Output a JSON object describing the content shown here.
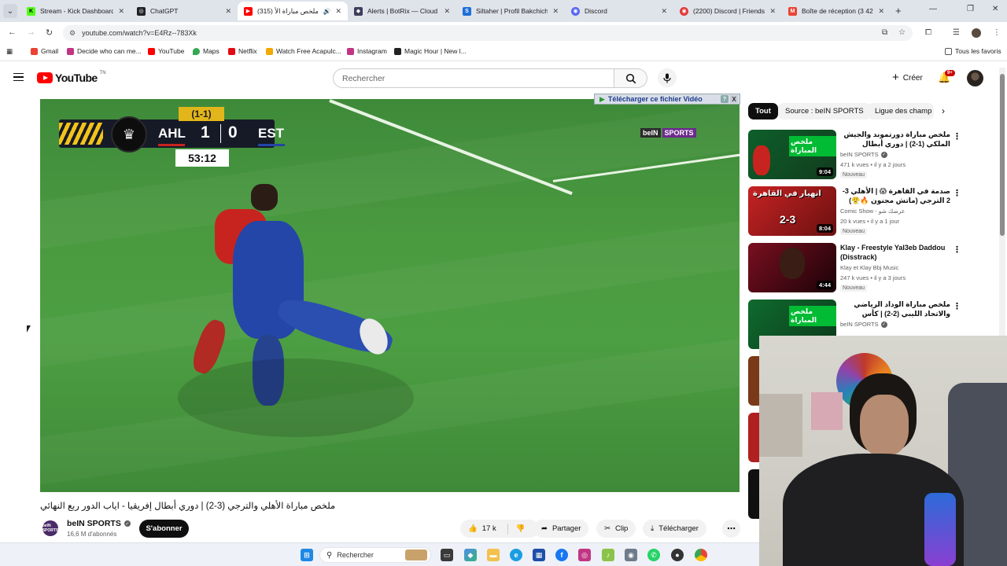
{
  "browser": {
    "tabs": [
      {
        "title": "Stream - Kick Dashboard",
        "color": "#53fc18",
        "glyph": "K"
      },
      {
        "title": "ChatGPT",
        "color": "#202123",
        "glyph": "◎"
      },
      {
        "title": "ملخص مباراة الأ (315)",
        "color": "#ff0000",
        "glyph": "▶"
      },
      {
        "title": "Alerts | BotRix — Cloud S",
        "color": "#3d3d5c",
        "glyph": "◆"
      },
      {
        "title": "Siltaher | Profil Bakchich",
        "color": "#1e6fd9",
        "glyph": "S"
      },
      {
        "title": "Discord",
        "color": "#5865f2",
        "glyph": "◉"
      },
      {
        "title": "(2200) Discord | Friends",
        "color": "#e03a3a",
        "glyph": "◉"
      },
      {
        "title": "Boîte de réception (3 42",
        "color": "#ea4335",
        "glyph": "M"
      }
    ],
    "new_tab": "+",
    "url": "youtube.com/watch?v=E4Rz--783Xk",
    "bookmarks": [
      {
        "label": "Gmail",
        "color": "#ea4335"
      },
      {
        "label": "Decide who can me...",
        "color": "#c13584"
      },
      {
        "label": "YouTube",
        "color": "#ff0000"
      },
      {
        "label": "Maps",
        "color": "#34a853"
      },
      {
        "label": "Netflix",
        "color": "#e50914"
      },
      {
        "label": "Watch Free Acapulc...",
        "color": "#f2a900"
      },
      {
        "label": "Instagram",
        "color": "#c13584"
      },
      {
        "label": "Magic Hour | New l...",
        "color": "#222222"
      }
    ],
    "all_favorites": "Tous les favoris"
  },
  "youtube": {
    "logo_text": "YouTube",
    "logo_country": "TN",
    "search_placeholder": "Rechercher",
    "create_label": "Créer",
    "notif_badge": "9+"
  },
  "player": {
    "scoreboard": {
      "home": "AHL",
      "home_goals": "1",
      "away": "EST",
      "away_goals": "0",
      "aggregate": "(1-1)",
      "clock": "53:12"
    },
    "watermark_a": "beIN",
    "watermark_b": "SPORTS",
    "download_overlay": "Télécharger ce fichier Vidéo",
    "download_help": "?",
    "download_close": "X"
  },
  "video": {
    "title": "ملخص مباراة الأهلي والترجي (3-2) | دوري أبطال إفريقيا - اياب الدور ربع النهائي",
    "channel": "beIN SPORTS",
    "channel_avatar": "beIN SPORTS",
    "subscribers": "16,6 M d'abonnés",
    "subscribe": "S'abonner",
    "likes": "17 k",
    "share": "Partager",
    "clip": "Clip",
    "download": "Télécharger"
  },
  "chips": [
    "Tout",
    "Source : beIN SPORTS",
    "Ligue des champ"
  ],
  "recommendations": [
    {
      "title": "ملخص مباراة دورتموند والجيش الملكي (1-2) | دوري أبطال إفريقيا - إياب ربع",
      "channel": "beIN SPORTS",
      "verified": true,
      "meta": "471 k vues • il y a 2 jours",
      "badge": "Nouveau",
      "duration": "9:04",
      "thumb_text": "ملخص المباراة",
      "colors": [
        "#0d5f2a",
        "#123c1e"
      ]
    },
    {
      "title": "صدمة في القاهرة 😱 | الأهلي 3-2 الترجي (ماتش مجنون 🔥😤)",
      "channel": "Comic Show - عرضك شو",
      "verified": false,
      "meta": "20 k vues • il y a 1 jour",
      "badge": "Nouveau",
      "duration": "8:04",
      "thumb_text": "انهيار في القاهرة",
      "colors": [
        "#c62323",
        "#6b1010"
      ]
    },
    {
      "title": "Klay - Freestyle Yal3eb Daddou (Disstrack)",
      "channel": "Klay et Klay Bbj Music",
      "verified": true,
      "meta": "247 k vues • il y a 3 jours",
      "badge": "Nouveau",
      "duration": "4:44",
      "thumb_text": "",
      "colors": [
        "#7a0f1f",
        "#1a0208"
      ]
    },
    {
      "title": "ملخص مباراة الوداد الرياضي والاتحاد الليبي (2-2) | كأس الاتحاد الإفريقي - إياب الدور",
      "channel": "beIN SPORTS",
      "verified": true,
      "meta": "",
      "badge": "",
      "duration": "",
      "thumb_text": "ملخص المباراة",
      "colors": [
        "#0f6b2e",
        "#0c3a1c"
      ]
    }
  ],
  "taskbar": {
    "search_placeholder": "Rechercher"
  }
}
